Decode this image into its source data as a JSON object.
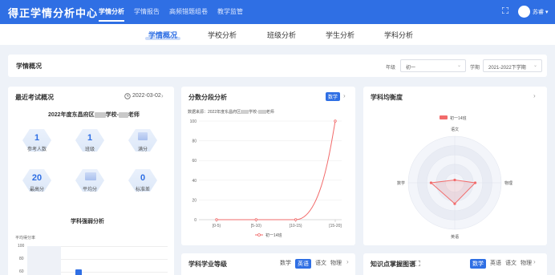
{
  "app": {
    "title": "得正学情分析中心",
    "topnav": [
      "学情分析",
      "学情报告",
      "高频错题组卷",
      "教学监管"
    ],
    "user": "苏睿"
  },
  "subnav": [
    "学情概况",
    "学校分析",
    "班级分析",
    "学生分析",
    "学科分析"
  ],
  "overview": {
    "title": "学情概况",
    "grade_label": "年级",
    "grade_value": "初一",
    "term_label": "学期",
    "term_value": "2021-2022下学期"
  },
  "recent_exam": {
    "title": "最近考试概况",
    "date": "2022-03-02",
    "exam_name": "2022年度东昌府区",
    "exam_name_mid": "学校-",
    "exam_name_suffix": "老师",
    "stats": [
      {
        "value": "1",
        "label": "参考人数"
      },
      {
        "value": "1",
        "label": "班级"
      },
      {
        "value": "",
        "label": "满分"
      },
      {
        "value": "20",
        "label": "最高分"
      },
      {
        "value": "",
        "label": "平均分"
      },
      {
        "value": "0",
        "label": "标准差"
      }
    ],
    "sub_title": "学科强弱分析",
    "axis_title": "平均得分率",
    "y_ticks": [
      "100",
      "80",
      "60"
    ]
  },
  "score_dist": {
    "title": "分数分段分析",
    "subject": "数学",
    "source": "数据来源：2022年度东昌府区",
    "source_mid": "学校-",
    "source_suffix": "老师",
    "legend": "初一14班"
  },
  "balance": {
    "title": "学科均衡度",
    "legend": "初一14班",
    "axes": [
      "语文",
      "物理",
      "英语",
      "数学"
    ]
  },
  "grade_level": {
    "title": "学科学业等级",
    "tabs": [
      "数学",
      "英语",
      "语文",
      "物理"
    ],
    "active": 1
  },
  "knowledge": {
    "title": "知识点掌握图谱",
    "tabs": [
      "数学",
      "英语",
      "语文",
      "物理"
    ],
    "active": 0
  },
  "chart_data": [
    {
      "type": "line",
      "title": "分数分段分析",
      "categories": [
        "[0-5)",
        "[5-10)",
        "[10-15)",
        "[15-20]"
      ],
      "series": [
        {
          "name": "初一14班",
          "values": [
            0,
            0,
            0,
            100
          ]
        }
      ],
      "y_ticks": [
        0,
        20,
        40,
        60,
        80,
        100
      ],
      "ylim": [
        0,
        100
      ],
      "color": "#f26b6b",
      "grid": true,
      "legend": "bottom"
    },
    {
      "type": "radar",
      "title": "学科均衡度",
      "axes": [
        "语文",
        "物理",
        "英语",
        "数学"
      ],
      "series": [
        {
          "name": "初一14班",
          "values": [
            0.06,
            0.44,
            0.45,
            0.51
          ]
        }
      ],
      "color": "#f26b6b",
      "legend": "top"
    }
  ],
  "colors": {
    "primary": "#2f6fe4",
    "accent": "#f26b6b"
  }
}
